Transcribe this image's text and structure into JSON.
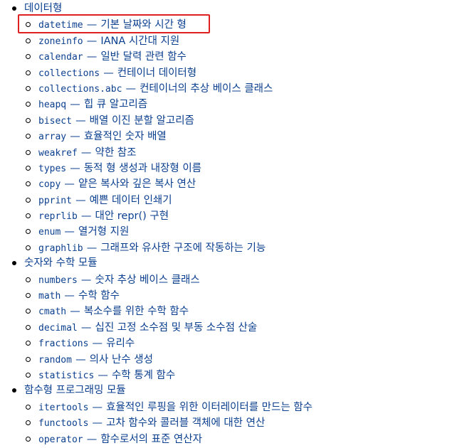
{
  "colors": {
    "link": "#0b3f8f",
    "highlight": "#e02020",
    "bullet": "#000000",
    "background": "#ffffff"
  },
  "highlight_label": "highlight-box",
  "sections": [
    {
      "title": "데이터형",
      "items": [
        {
          "module": "datetime",
          "dash": "—",
          "desc": "기본 날짜와 시간 형",
          "highlighted": true
        },
        {
          "module": "zoneinfo",
          "dash": "—",
          "desc": "IANA 시간대 지원"
        },
        {
          "module": "calendar",
          "dash": "—",
          "desc": "일반 달력 관련 함수"
        },
        {
          "module": "collections",
          "dash": "—",
          "desc": "컨테이너 데이터형"
        },
        {
          "module": "collections.abc",
          "dash": "—",
          "desc": "컨테이너의 추상 베이스 클래스"
        },
        {
          "module": "heapq",
          "dash": "—",
          "desc": "힙 큐 알고리즘"
        },
        {
          "module": "bisect",
          "dash": "—",
          "desc": "배열 이진 분할 알고리즘"
        },
        {
          "module": "array",
          "dash": "—",
          "desc": "효율적인 숫자 배열"
        },
        {
          "module": "weakref",
          "dash": "—",
          "desc": "약한 참조"
        },
        {
          "module": "types",
          "dash": "—",
          "desc": "동적 형 생성과 내장형 이름"
        },
        {
          "module": "copy",
          "dash": "—",
          "desc": "얕은 복사와 깊은 복사 연산"
        },
        {
          "module": "pprint",
          "dash": "—",
          "desc": "예쁜 데이터 인쇄기"
        },
        {
          "module": "reprlib",
          "dash": "—",
          "desc": "대안 repr() 구현"
        },
        {
          "module": "enum",
          "dash": "—",
          "desc": "열거형 지원"
        },
        {
          "module": "graphlib",
          "dash": "—",
          "desc": "그래프와 유사한 구조에 작동하는 기능"
        }
      ]
    },
    {
      "title": "숫자와 수학 모듈",
      "items": [
        {
          "module": "numbers",
          "dash": "—",
          "desc": "숫자 추상 베이스 클래스"
        },
        {
          "module": "math",
          "dash": "—",
          "desc": "수학 함수"
        },
        {
          "module": "cmath",
          "dash": "—",
          "desc": "복소수를 위한 수학 함수"
        },
        {
          "module": "decimal",
          "dash": "—",
          "desc": "십진 고정 소수점 및 부동 소수점 산술"
        },
        {
          "module": "fractions",
          "dash": "—",
          "desc": "유리수"
        },
        {
          "module": "random",
          "dash": "—",
          "desc": "의사 난수 생성"
        },
        {
          "module": "statistics",
          "dash": "—",
          "desc": "수학 통계 함수"
        }
      ]
    },
    {
      "title": "함수형 프로그래밍 모듈",
      "items": [
        {
          "module": "itertools",
          "dash": "—",
          "desc": "효율적인 루핑을 위한 이터레이터를 만드는 함수"
        },
        {
          "module": "functools",
          "dash": "—",
          "desc": "고차 함수와 콜러블 객체에 대한 연산"
        },
        {
          "module": "operator",
          "dash": "—",
          "desc": "함수로서의 표준 연산자"
        }
      ]
    }
  ]
}
